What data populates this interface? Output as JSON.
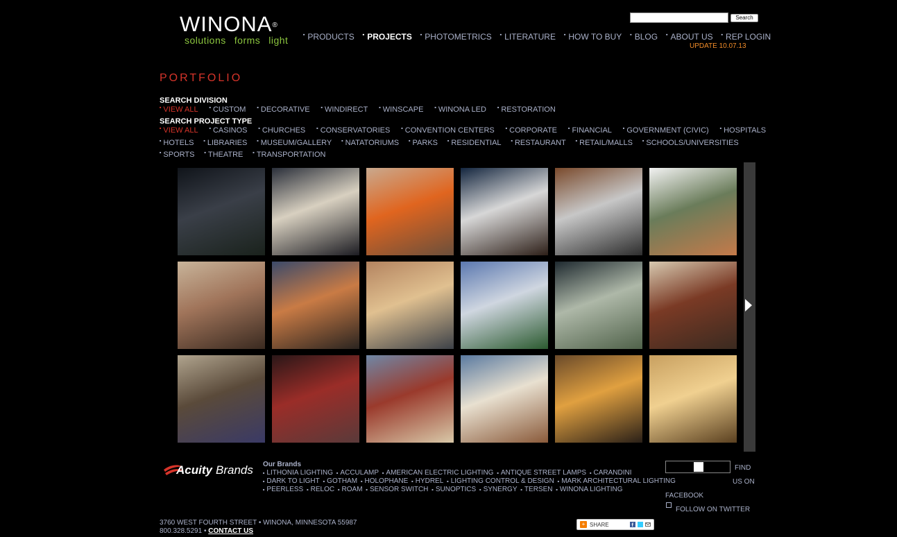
{
  "brand": {
    "name": "WINONA",
    "reg": "®",
    "tagline": [
      "solutions",
      "forms",
      "light"
    ]
  },
  "search": {
    "value": "",
    "button_label": "Search"
  },
  "nav": {
    "items": [
      {
        "label": "PRODUCTS",
        "active": false
      },
      {
        "label": "PROJECTS",
        "active": true
      },
      {
        "label": "PHOTOMETRICS",
        "active": false
      },
      {
        "label": "LITERATURE",
        "active": false
      },
      {
        "label": "HOW TO BUY",
        "active": false
      },
      {
        "label": "BLOG",
        "active": false
      },
      {
        "label": "ABOUT US",
        "active": false
      },
      {
        "label": "REP LOGIN",
        "active": false
      }
    ],
    "update": "UPDATE 10.07.13"
  },
  "page_title": "PORTFOLIO",
  "division": {
    "heading": "SEARCH DIVISION",
    "items": [
      "VIEW ALL",
      "CUSTOM",
      "DECORATIVE",
      "WINDIRECT",
      "WINSCAPE",
      "WINONA LED",
      "RESTORATION"
    ]
  },
  "project_type": {
    "heading": "SEARCH PROJECT TYPE",
    "rows": [
      [
        "VIEW ALL",
        "CASINOS",
        "CHURCHES",
        "CONSERVATORIES",
        "CONVENTION CENTERS",
        "CORPORATE",
        "FINANCIAL",
        "GOVERNMENT (CIVIC)",
        "HOSPITALS"
      ],
      [
        "HOTELS",
        "LIBRARIES",
        "MUSEUM/GALLERY",
        "NATATORIUMS",
        "PARKS",
        "RESIDENTIAL",
        "RESTAURANT",
        "RETAIL/MALLS",
        "SCHOOLS/UNIVERSITIES"
      ],
      [
        "SPORTS",
        "THEATRE",
        "TRANSPORTATION"
      ]
    ]
  },
  "thumbnails": [
    {
      "name": "hospital-exterior-thumb",
      "colors": [
        "#10141a",
        "#3a3f48",
        "#1a221c"
      ]
    },
    {
      "name": "plaza-night-thumb",
      "colors": [
        "#2a2f3a",
        "#d8d0c0",
        "#1c1c22"
      ]
    },
    {
      "name": "lounge-interior-thumb",
      "colors": [
        "#c9a98e",
        "#e0651f",
        "#6b4f3b"
      ]
    },
    {
      "name": "restaurant-blue-thumb",
      "colors": [
        "#14263f",
        "#d7d7d7",
        "#2d1f18"
      ]
    },
    {
      "name": "stair-wood-thumb",
      "colors": [
        "#7a4a2c",
        "#c7c7c7",
        "#2d2d2d"
      ]
    },
    {
      "name": "atrium-windows-thumb",
      "colors": [
        "#f2f2f2",
        "#6a7c5a",
        "#c47a4a"
      ]
    },
    {
      "name": "atrium-stair-thumb",
      "colors": [
        "#c8b49a",
        "#a0745a",
        "#3a2a20"
      ]
    },
    {
      "name": "lobby-tall-thumb",
      "colors": [
        "#3b4a6a",
        "#c97b45",
        "#2a2420"
      ]
    },
    {
      "name": "church-arches-thumb",
      "colors": [
        "#b48460",
        "#e0c090",
        "#3c4148"
      ]
    },
    {
      "name": "modern-building-thumb",
      "colors": [
        "#5b78b0",
        "#cfd6e0",
        "#2b5a2f"
      ]
    },
    {
      "name": "glass-conservatory-thumb",
      "colors": [
        "#1f2a30",
        "#aeb8a8",
        "#50624a"
      ]
    },
    {
      "name": "library-room-thumb",
      "colors": [
        "#d7c9b0",
        "#7a3a25",
        "#3a2a20"
      ]
    },
    {
      "name": "grand-hall-thumb",
      "colors": [
        "#b0a48e",
        "#5a4a3a",
        "#3a3a66"
      ]
    },
    {
      "name": "red-theatre-thumb",
      "colors": [
        "#2a1718",
        "#9a2d28",
        "#5a3a3a"
      ]
    },
    {
      "name": "ornate-chamber-thumb",
      "colors": [
        "#6f87a6",
        "#9a3a2c",
        "#d8c8a8"
      ]
    },
    {
      "name": "hotel-lobby-thumb",
      "colors": [
        "#5a7aa0",
        "#e8e0d0",
        "#8a5a3a"
      ]
    },
    {
      "name": "bar-counter-thumb",
      "colors": [
        "#6a4a2a",
        "#e0a040",
        "#2a2018"
      ]
    },
    {
      "name": "gold-corridor-thumb",
      "colors": [
        "#c8a060",
        "#f0d090",
        "#5a4020"
      ]
    }
  ],
  "footer": {
    "acuity_logo": "AcuityBrands",
    "brands_title": "Our Brands",
    "brand_lines": [
      [
        "LITHONIA LIGHTING",
        "ACCULAMP",
        "AMERICAN ELECTRIC LIGHTING",
        "ANTIQUE STREET LAMPS",
        "CARANDINI"
      ],
      [
        "DARK TO LIGHT",
        "GOTHAM",
        "HOLOPHANE",
        "HYDREL",
        "LIGHTING CONTROL & DESIGN",
        "MARK ARCHITECTURAL LIGHTING"
      ],
      [
        "PEERLESS",
        "RELOC",
        "ROAM",
        "SENSOR SWITCH",
        "SUNOPTICS",
        "SYNERGY",
        "TERSEN",
        "WINONA LIGHTING"
      ]
    ],
    "social": {
      "find1": "FIND",
      "find2": "US ON",
      "find3": "FACEBOOK",
      "follow": "FOLLOW ON TWITTER"
    },
    "address": "3760 WEST FOURTH STREET • WINONA, MINNESOTA 55987",
    "phone": "800.328.5291 •",
    "contact": "CONTACT US",
    "share_label": "SHARE"
  },
  "colors": {
    "accent_red": "#d6342a",
    "update_orange": "#f28c28",
    "link": "#aab1c9",
    "logo_green": "#8cc63f"
  }
}
